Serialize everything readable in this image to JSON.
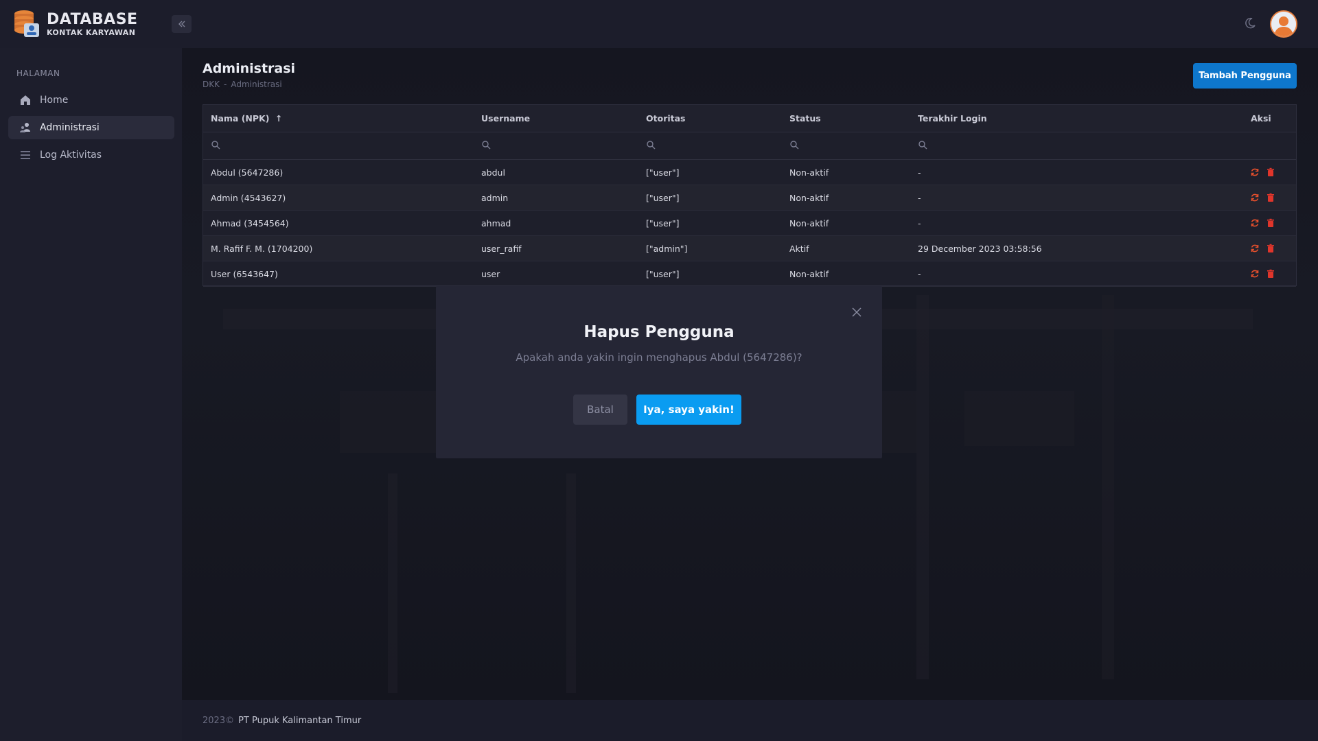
{
  "brand": {
    "title": "DATABASE",
    "subtitle": "KONTAK KARYAWAN"
  },
  "sidebar": {
    "heading": "HALAMAN",
    "items": [
      {
        "label": "Home",
        "icon": "home-icon"
      },
      {
        "label": "Administrasi",
        "icon": "users-icon",
        "active": true
      },
      {
        "label": "Log Aktivitas",
        "icon": "list-icon"
      }
    ]
  },
  "page": {
    "title": "Administrasi",
    "breadcrumb": [
      "DKK",
      "-",
      "Administrasi"
    ],
    "add_button": "Tambah Pengguna"
  },
  "table": {
    "columns": [
      "Nama (NPK)",
      "Username",
      "Otoritas",
      "Status",
      "Terakhir Login",
      "Aksi"
    ],
    "sort_indicator": "↑",
    "rows": [
      {
        "name": "Abdul (5647286)",
        "username": "abdul",
        "authority": "[\"user\"]",
        "status": "Non-aktif",
        "last_login": "-"
      },
      {
        "name": "Admin (4543627)",
        "username": "admin",
        "authority": "[\"user\"]",
        "status": "Non-aktif",
        "last_login": "-"
      },
      {
        "name": "Ahmad (3454564)",
        "username": "ahmad",
        "authority": "[\"user\"]",
        "status": "Non-aktif",
        "last_login": "-"
      },
      {
        "name": "M. Rafif F. M. (1704200)",
        "username": "user_rafif",
        "authority": "[\"admin\"]",
        "status": "Aktif",
        "last_login": "29 December 2023 03:58:56"
      },
      {
        "name": "User (6543647)",
        "username": "user",
        "authority": "[\"user\"]",
        "status": "Non-aktif",
        "last_login": "-"
      }
    ]
  },
  "modal": {
    "title": "Hapus Pengguna",
    "message": "Apakah anda yakin ingin menghapus Abdul (5647286)?",
    "cancel": "Batal",
    "confirm": "Iya, saya yakin!"
  },
  "footer": {
    "year": "2023©",
    "company": "PT Pupuk Kalimantan Timur"
  },
  "colors": {
    "primary": "#0e77cc",
    "confirm": "#0a9cf1",
    "danger": "#e0352b",
    "reset": "#e8502c"
  }
}
